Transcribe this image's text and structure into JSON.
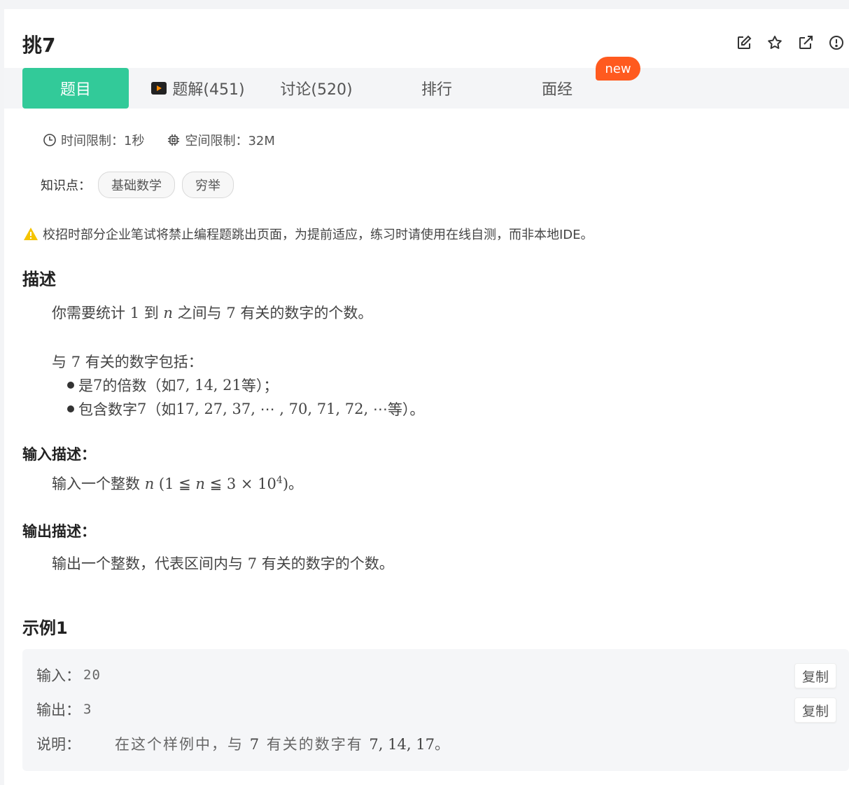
{
  "problem": {
    "title": "挑7"
  },
  "tabs": [
    {
      "label": "题目"
    },
    {
      "label": "题解(451)"
    },
    {
      "label": "讨论(520)"
    },
    {
      "label": "排行"
    },
    {
      "label": "面经"
    }
  ],
  "badge": {
    "new": "new"
  },
  "limits": {
    "time": "时间限制：1秒",
    "space": "空间限制：32M"
  },
  "knowledge": {
    "label": "知识点：",
    "tags": [
      "基础数学",
      "穷举"
    ]
  },
  "warning": "校招时部分企业笔试将禁止编程题跳出页面，为提前适应，练习时请使用在线自测，而非本地IDE。",
  "description": {
    "heading": "描述",
    "line1_a": "你需要统计 ",
    "line1_n1": "1",
    "line1_b": " 到 ",
    "line1_n": "n",
    "line1_c": " 之间与 ",
    "line1_n7": "7",
    "line1_d": " 有关的数字的个数。",
    "line2_a": "与 ",
    "line2_n7": "7",
    "line2_b": " 有关的数字包括：",
    "bullet1_a": "是 ",
    "bullet1_n7": "7",
    "bullet1_b": " 的倍数（如 ",
    "bullet1_ex": "7, 14, 21",
    "bullet1_c": " 等）；",
    "bullet2_a": "包含数字 ",
    "bullet2_n7": "7",
    "bullet2_b": "（如 ",
    "bullet2_ex": "17, 27, 37, ⋯ , 70, 71, 72, ⋯",
    "bullet2_c": " 等）。"
  },
  "input_desc": {
    "heading": "输入描述：",
    "text_a": "输入一个整数 ",
    "n": "n",
    "range_a": " (1 ≦ ",
    "range_n": "n",
    "range_b": " ≦ 3 × 10",
    "exp": "4",
    "range_c": ")",
    "end": "。"
  },
  "output_desc": {
    "heading": "输出描述：",
    "text_a": "输出一个整数，代表区间内与 ",
    "n7": "7",
    "text_b": " 有关的数字的个数。"
  },
  "example": {
    "heading": "示例1",
    "input_label": "输入：",
    "input_value": "20",
    "output_label": "输出：",
    "output_value": "3",
    "explain_label": "说明：",
    "explain_a": "在这个样例中，与 ",
    "explain_n7": "7",
    "explain_b": " 有关的数字有 ",
    "explain_ex": "7, 14, 17",
    "explain_c": "。",
    "copy": "复制"
  }
}
